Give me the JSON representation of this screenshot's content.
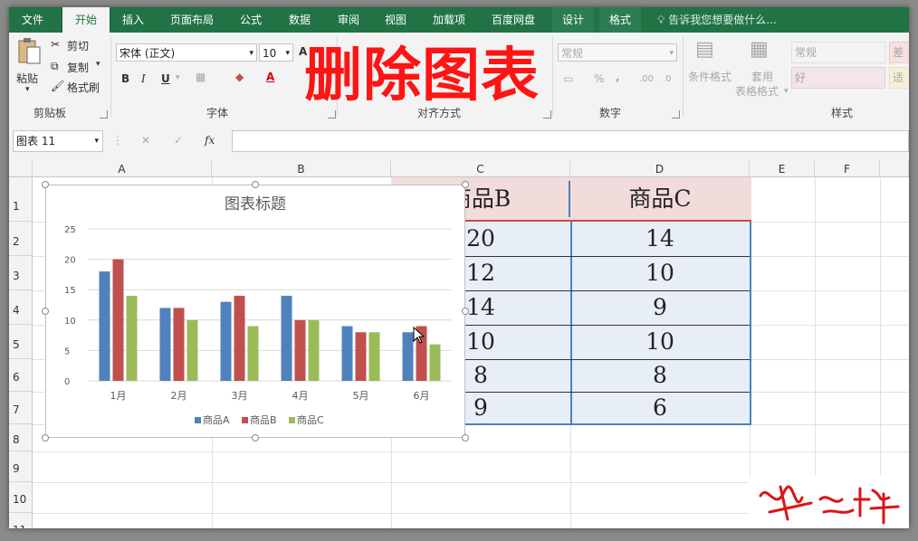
{
  "tabs": [
    {
      "label": "文件",
      "active": false
    },
    {
      "label": "开始",
      "active": true
    },
    {
      "label": "插入",
      "active": false
    },
    {
      "label": "页面布局",
      "active": false
    },
    {
      "label": "公式",
      "active": false
    },
    {
      "label": "数据",
      "active": false
    },
    {
      "label": "审阅",
      "active": false
    },
    {
      "label": "视图",
      "active": false
    },
    {
      "label": "加载项",
      "active": false
    },
    {
      "label": "百度网盘",
      "active": false
    },
    {
      "label": "设计",
      "active": false
    },
    {
      "label": "格式",
      "active": false
    }
  ],
  "tell_me": "告诉我您想要做什么...",
  "clipboard": {
    "paste": "粘贴",
    "cut": "剪切",
    "copy": "复制",
    "format_painter": "格式刷",
    "label": "剪贴板"
  },
  "font": {
    "name": "宋体 (正文)",
    "size": "10",
    "bold": "B",
    "italic": "I",
    "underline": "U",
    "label": "字体"
  },
  "alignment": {
    "label": "对齐方式"
  },
  "number": {
    "format": "常规",
    "percent": "%",
    "comma": ",",
    "label": "数字"
  },
  "styles": {
    "conditional": "条件格式",
    "table_format_1": "套用",
    "table_format_2": "表格格式",
    "normal": "常规",
    "bad": "差",
    "good": "好",
    "neutral": "适",
    "label": "样式"
  },
  "overlay_title": "删除图表",
  "name_box": "图表 11",
  "fx": "fx",
  "columns": [
    "A",
    "B",
    "C",
    "D",
    "E",
    "F"
  ],
  "rows": [
    "1",
    "2",
    "3",
    "4",
    "5",
    "6",
    "7",
    "8",
    "9",
    "10",
    "11"
  ],
  "table": {
    "header": [
      "商品B",
      "商品C"
    ],
    "col_c": [
      "20",
      "12",
      "14",
      "10",
      "8",
      "9"
    ],
    "col_d": [
      "14",
      "10",
      "9",
      "10",
      "8",
      "6"
    ]
  },
  "colors": {
    "green": "#217346",
    "series_a": "#4f81bd",
    "series_b": "#c0504d",
    "series_c": "#9bbb59",
    "overlay": "#ff1414"
  },
  "chart_data": {
    "type": "bar",
    "title": "图表标题",
    "categories": [
      "1月",
      "2月",
      "3月",
      "4月",
      "5月",
      "6月"
    ],
    "series": [
      {
        "name": "商品A",
        "values": [
          18,
          12,
          13,
          14,
          9,
          8
        ]
      },
      {
        "name": "商品B",
        "values": [
          20,
          12,
          14,
          10,
          8,
          9
        ]
      },
      {
        "name": "商品C",
        "values": [
          14,
          10,
          9,
          10,
          8,
          6
        ]
      }
    ],
    "ylim": [
      0,
      25
    ],
    "yticks": [
      0,
      5,
      10,
      15,
      20,
      25
    ],
    "grid": true,
    "legend": "bottom"
  }
}
